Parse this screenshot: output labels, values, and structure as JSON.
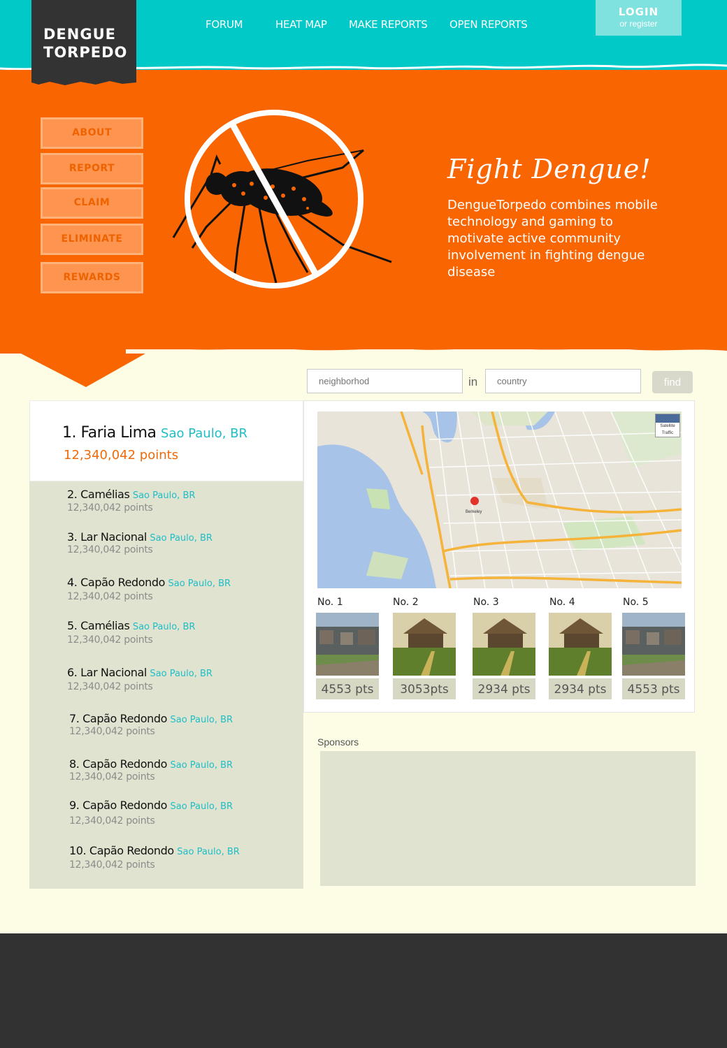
{
  "logo": {
    "line1": "DENGUE",
    "line2": "TORPEDO"
  },
  "nav": [
    {
      "label": "FORUM"
    },
    {
      "label": "HEAT MAP"
    },
    {
      "label": "MAKE REPORTS"
    },
    {
      "label": "OPEN REPORTS"
    }
  ],
  "login": {
    "title": "LOGIN",
    "subtitle": "or register"
  },
  "sidebar": [
    {
      "label": "ABOUT"
    },
    {
      "label": "REPORT"
    },
    {
      "label": "CLAIM"
    },
    {
      "label": "ELIMINATE"
    },
    {
      "label": "REWARDS"
    }
  ],
  "hero": {
    "title": "Fight Dengue!",
    "description": "DengueTorpedo combines mobile technology and gaming to motivate active community involvement in fighting dengue disease"
  },
  "search": {
    "neighborhood_placeholder": "neighborhod",
    "in_label": "in",
    "country_placeholder": "country",
    "find_label": "find"
  },
  "leaderboard": {
    "top": {
      "name": "1. Faria Lima",
      "location": "Sao Paulo, BR",
      "points": "12,340,042 points"
    },
    "entries": [
      {
        "name": "2. Camélias",
        "location": "Sao Paulo, BR",
        "points": "12,340,042 points"
      },
      {
        "name": "3. Lar Nacional",
        "location": "Sao Paulo, BR",
        "points": "12,340,042 points"
      },
      {
        "name": "4. Capão Redondo",
        "location": "Sao Paulo, BR",
        "points": "12,340,042 points"
      },
      {
        "name": "5. Camélias",
        "location": "Sao Paulo, BR",
        "points": "12,340,042 points"
      },
      {
        "name": "6. Lar Nacional",
        "location": "Sao Paulo, BR",
        "points": "12,340,042 points"
      },
      {
        "name": "7. Capão Redondo",
        "location": "Sao Paulo, BR",
        "points": "12,340,042 points"
      },
      {
        "name": "8. Capão Redondo",
        "location": "Sao Paulo, BR",
        "points": "12,340,042 points"
      },
      {
        "name": "9. Capão Redondo",
        "location": "Sao Paulo, BR",
        "points": "12,340,042 points"
      },
      {
        "name": "10. Capão Redondo",
        "location": "Sao Paulo, BR",
        "points": "12,340,042 points"
      }
    ]
  },
  "map": {
    "controls": [
      "Satellite",
      "Traffic"
    ]
  },
  "reports": [
    {
      "label": "No. 1",
      "points": "4553 pts",
      "photo": "slum"
    },
    {
      "label": "No. 2",
      "points": "3053pts",
      "photo": "hut"
    },
    {
      "label": "No. 3",
      "points": "2934 pts",
      "photo": "hut"
    },
    {
      "label": "No. 4",
      "points": "2934 pts",
      "photo": "hut"
    },
    {
      "label": "No. 5",
      "points": "4553 pts",
      "photo": "slum"
    }
  ],
  "sponsors": {
    "label": "Sponsors"
  },
  "colors": {
    "header": "#00c9c8",
    "hero": "#f96500",
    "accent": "#1ebec6",
    "points": "#f06a0a",
    "footer": "#323232"
  }
}
